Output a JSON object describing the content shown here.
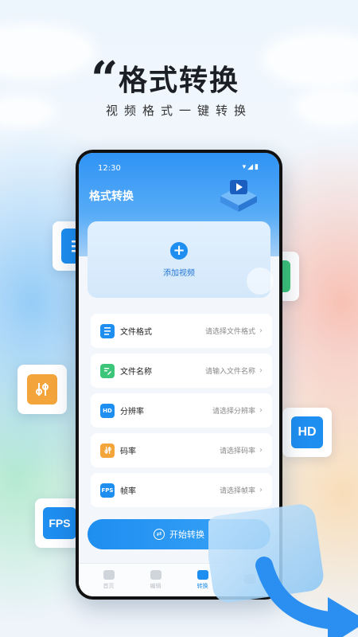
{
  "hero": {
    "title": "格式转换",
    "subtitle": "视频格式一键转换"
  },
  "status_bar": {
    "time": "12:30",
    "icons": "▾◢▮"
  },
  "app": {
    "title": "格式转换",
    "add_video_label": "添加视频",
    "add_symbol": "+",
    "rows": [
      {
        "label": "文件格式",
        "value": "请选择文件格式",
        "icon": "document-icon",
        "color": "#1e8ef0"
      },
      {
        "label": "文件名称",
        "value": "请输入文件名称",
        "icon": "edit-icon",
        "color": "#3dc57a"
      },
      {
        "label": "分辨率",
        "value": "请选择分辨率",
        "icon": "hd-icon",
        "icon_text": "HD",
        "color": "#1e8ef0"
      },
      {
        "label": "码率",
        "value": "请选择码率",
        "icon": "sliders-icon",
        "color": "#f3a53b"
      },
      {
        "label": "帧率",
        "value": "请选择帧率",
        "icon": "fps-icon",
        "icon_text": "FPS",
        "color": "#1e8ef0"
      }
    ],
    "chevron": "›",
    "start_label": "开始转换",
    "start_symbol": "⇄",
    "tabs": [
      {
        "label": "首页",
        "icon": "home-icon",
        "active": false
      },
      {
        "label": "编辑",
        "icon": "video-icon",
        "active": false
      },
      {
        "label": "转换",
        "icon": "convert-icon",
        "active": true
      },
      {
        "label": "",
        "icon": "profile-icon",
        "active": false
      }
    ]
  },
  "floating_badges": {
    "hd_text": "HD",
    "fps_text": "FPS"
  },
  "colors": {
    "accent": "#1e8ef0",
    "green": "#3dc57a",
    "orange": "#f3a53b"
  }
}
